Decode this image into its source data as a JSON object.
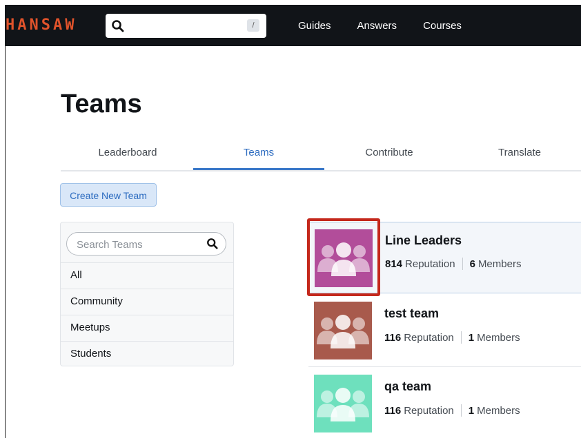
{
  "brand": {
    "logo": "HANSAW",
    "logo_color": "#e0532b"
  },
  "search": {
    "value": "",
    "placeholder": "",
    "shortcut": "/"
  },
  "nav": {
    "links": [
      "Guides",
      "Answers",
      "Courses"
    ]
  },
  "page": {
    "title": "Teams"
  },
  "tabs": [
    {
      "label": "Leaderboard",
      "active": false
    },
    {
      "label": "Teams",
      "active": true
    },
    {
      "label": "Contribute",
      "active": false
    },
    {
      "label": "Translate",
      "active": false
    }
  ],
  "actions": {
    "create_label": "Create New Team"
  },
  "filter": {
    "search_placeholder": "Search Teams",
    "items": [
      "All",
      "Community",
      "Meetups",
      "Students"
    ]
  },
  "teams": [
    {
      "name": "Line Leaders",
      "reputation": "814",
      "reputation_label": "Reputation",
      "members": "6",
      "members_label": "Members",
      "color": "#b24d9a",
      "icon": "group-icon",
      "selected": true
    },
    {
      "name": "test team",
      "reputation": "116",
      "reputation_label": "Reputation",
      "members": "1",
      "members_label": "Members",
      "color": "#a85a4c",
      "icon": "group-icon",
      "selected": false
    },
    {
      "name": "qa team",
      "reputation": "116",
      "reputation_label": "Reputation",
      "members": "1",
      "members_label": "Members",
      "color": "#6ee0bd",
      "icon": "group-icon",
      "selected": false
    }
  ],
  "colors": {
    "accent": "#2d6cc0",
    "navbar": "#111418",
    "highlight": "#c4281c"
  }
}
